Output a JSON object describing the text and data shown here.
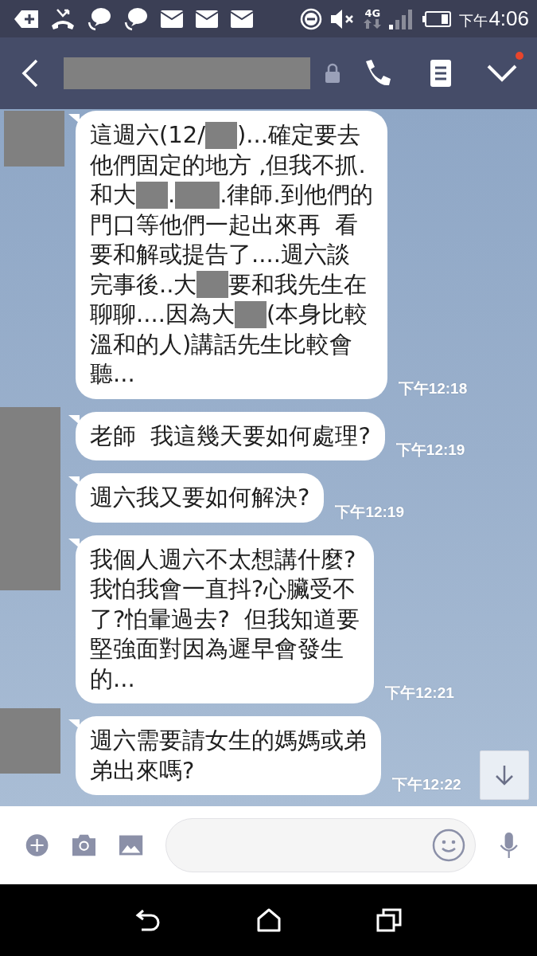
{
  "status_bar": {
    "ampm": "下午",
    "time": "4:06",
    "network": "4G"
  },
  "header": {
    "title_redacted": true,
    "unread_dot": true
  },
  "messages": [
    {
      "kind": "cut",
      "time": "下午12:18",
      "lines": [
        [
          {
            "kind": "text",
            "text": "這週六(12/"
          },
          {
            "kind": "redacted"
          },
          {
            "kind": "text",
            "text": ")...確定要去"
          }
        ],
        [
          {
            "kind": "text",
            "text": "他們固定的地方 ,但我不抓."
          }
        ],
        [
          {
            "kind": "text",
            "text": "和大"
          },
          {
            "kind": "redacted"
          },
          {
            "kind": "text",
            "text": "."
          },
          {
            "kind": "redacted",
            "wide": true
          },
          {
            "kind": "text",
            "text": ".律師.到他們的"
          }
        ],
        [
          {
            "kind": "text",
            "text": "門口等他們一起出來再  看"
          }
        ],
        [
          {
            "kind": "text",
            "text": "要和解或提告了....週六談"
          }
        ],
        [
          {
            "kind": "text",
            "text": "完事後..大"
          },
          {
            "kind": "redacted"
          },
          {
            "kind": "text",
            "text": "要和我先生在"
          }
        ],
        [
          {
            "kind": "text",
            "text": "聊聊....因為大"
          },
          {
            "kind": "redacted"
          },
          {
            "kind": "text",
            "text": "(本身比較"
          }
        ],
        [
          {
            "kind": "text",
            "text": "溫和的人)講話先生比較會"
          }
        ],
        [
          {
            "kind": "text",
            "text": "聽..."
          }
        ]
      ]
    },
    {
      "kind": "tall",
      "time": "下午12:19",
      "lines": [
        [
          {
            "kind": "text",
            "text": "老師  我這幾天要如何處理?"
          }
        ]
      ]
    },
    {
      "kind": "plain",
      "time": "下午12:19",
      "lines": [
        [
          {
            "kind": "text",
            "text": "週六我又要如何解決?"
          }
        ]
      ]
    },
    {
      "kind": "plain",
      "time": "下午12:21",
      "lines": [
        [
          {
            "kind": "text",
            "text": "我個人週六不太想講什麼?"
          }
        ],
        [
          {
            "kind": "text",
            "text": "我怕我會一直抖?心臟受不"
          }
        ],
        [
          {
            "kind": "text",
            "text": "了?怕暈過去?  但我知道要"
          }
        ],
        [
          {
            "kind": "text",
            "text": "堅強面對因為遲早會發生"
          }
        ],
        [
          {
            "kind": "text",
            "text": "的..."
          }
        ]
      ]
    },
    {
      "kind": "square",
      "time": "下午12:22",
      "lines": [
        [
          {
            "kind": "text",
            "text": "週六需要請女生的媽媽或弟"
          }
        ],
        [
          {
            "kind": "text",
            "text": "弟出來嗎?"
          }
        ]
      ]
    }
  ],
  "scroll_down_button": true
}
